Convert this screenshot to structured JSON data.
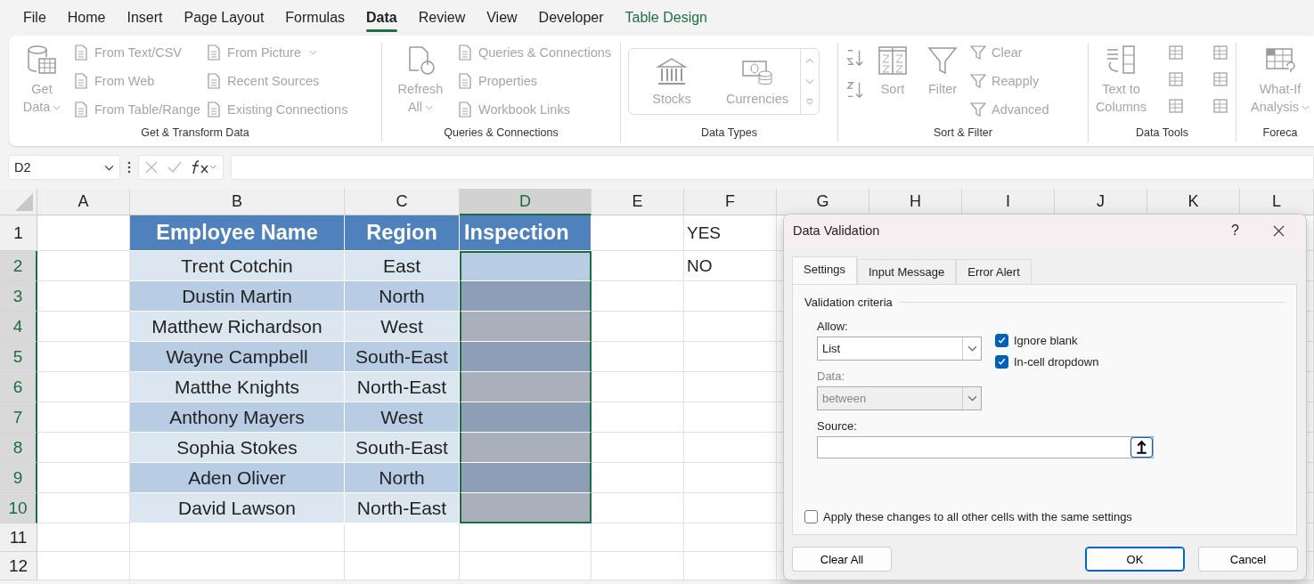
{
  "menu_tabs": [
    {
      "label": "File",
      "selected": false,
      "kind": "standard"
    },
    {
      "label": "Home",
      "selected": false,
      "kind": "standard"
    },
    {
      "label": "Insert",
      "selected": false,
      "kind": "standard"
    },
    {
      "label": "Page Layout",
      "selected": false,
      "kind": "standard"
    },
    {
      "label": "Formulas",
      "selected": false,
      "kind": "standard"
    },
    {
      "label": "Data",
      "selected": true,
      "kind": "standard"
    },
    {
      "label": "Review",
      "selected": false,
      "kind": "standard"
    },
    {
      "label": "View",
      "selected": false,
      "kind": "standard"
    },
    {
      "label": "Developer",
      "selected": false,
      "kind": "standard"
    },
    {
      "label": "Table Design",
      "selected": false,
      "kind": "contextual"
    }
  ],
  "ribbon": {
    "disabled": true,
    "groups": [
      {
        "label": "Get & Transform Data",
        "columns": [
          {
            "kind": "large",
            "items": [
              {
                "label": "Get Data",
                "dropdown": true
              }
            ]
          },
          {
            "kind": "small",
            "items": [
              {
                "label": "From Text/CSV",
                "dropdown": false
              },
              {
                "label": "From Web",
                "dropdown": false
              },
              {
                "label": "From Table/Range",
                "dropdown": false
              }
            ]
          },
          {
            "kind": "small",
            "items": [
              {
                "label": "From Picture",
                "dropdown": true
              },
              {
                "label": "Recent Sources",
                "dropdown": false
              },
              {
                "label": "Existing Connections",
                "dropdown": false
              }
            ]
          }
        ]
      },
      {
        "label": "Queries & Connections",
        "columns": [
          {
            "kind": "large",
            "items": [
              {
                "label": "Refresh All",
                "dropdown": true
              }
            ]
          },
          {
            "kind": "small",
            "items": [
              {
                "label": "Queries & Connections",
                "dropdown": false
              },
              {
                "label": "Properties",
                "dropdown": false
              },
              {
                "label": "Workbook Links",
                "dropdown": false
              }
            ]
          }
        ]
      },
      {
        "label": "Data Types",
        "columns": [
          {
            "kind": "gallery",
            "items": [
              {
                "label": "Stocks"
              },
              {
                "label": "Currencies"
              }
            ]
          }
        ]
      },
      {
        "label": "Sort & Filter",
        "columns": [
          {
            "kind": "sortpair"
          },
          {
            "kind": "large",
            "items": [
              {
                "label": "Sort",
                "dropdown": false
              }
            ]
          },
          {
            "kind": "large",
            "items": [
              {
                "label": "Filter",
                "dropdown": false
              }
            ]
          },
          {
            "kind": "small",
            "items": [
              {
                "label": "Clear",
                "dropdown": false
              },
              {
                "label": "Reapply",
                "dropdown": false
              },
              {
                "label": "Advanced",
                "dropdown": false
              }
            ]
          }
        ]
      },
      {
        "label": "Data Tools",
        "columns": [
          {
            "kind": "large",
            "items": [
              {
                "label": "Text to Columns",
                "dropdown": false
              }
            ]
          },
          {
            "kind": "tools"
          }
        ]
      },
      {
        "label": "Foreca",
        "columns": [
          {
            "kind": "large",
            "items": [
              {
                "label": "What-If Analysis",
                "dropdown": true
              }
            ]
          }
        ]
      }
    ]
  },
  "formula_bar": {
    "name_box": "D2"
  },
  "sheet": {
    "columns": [
      {
        "label": "A",
        "selected": false
      },
      {
        "label": "B",
        "selected": false
      },
      {
        "label": "C",
        "selected": false
      },
      {
        "label": "D",
        "selected": true
      },
      {
        "label": "E",
        "selected": false
      },
      {
        "label": "F",
        "selected": false
      },
      {
        "label": "G",
        "selected": false
      },
      {
        "label": "H",
        "selected": false
      },
      {
        "label": "I",
        "selected": false
      },
      {
        "label": "J",
        "selected": false
      },
      {
        "label": "K",
        "selected": false
      },
      {
        "label": "L",
        "selected": false
      }
    ],
    "rows": [
      {
        "number": "1",
        "selected": false,
        "kind": "header",
        "name": "Employee Name",
        "region": "Region",
        "inspection": "Inspection",
        "column_f": "YES"
      },
      {
        "number": "2",
        "selected": true,
        "kind": "data",
        "name": "Trent Cotchin",
        "region": "East",
        "column_f": "NO"
      },
      {
        "number": "3",
        "selected": true,
        "kind": "data",
        "name": "Dustin Martin",
        "region": "North"
      },
      {
        "number": "4",
        "selected": true,
        "kind": "data",
        "name": "Matthew Richardson",
        "region": "West"
      },
      {
        "number": "5",
        "selected": true,
        "kind": "data",
        "name": "Wayne Campbell",
        "region": "South-East"
      },
      {
        "number": "6",
        "selected": true,
        "kind": "data",
        "name": "Matthe Knights",
        "region": "North-East"
      },
      {
        "number": "7",
        "selected": true,
        "kind": "data",
        "name": "Anthony Mayers",
        "region": "West"
      },
      {
        "number": "8",
        "selected": true,
        "kind": "data",
        "name": "Sophia Stokes",
        "region": "South-East"
      },
      {
        "number": "9",
        "selected": true,
        "kind": "data",
        "name": "Aden Oliver",
        "region": "North"
      },
      {
        "number": "10",
        "selected": true,
        "kind": "data",
        "name": "David Lawson",
        "region": "North-East"
      },
      {
        "number": "11",
        "selected": false,
        "kind": "empty"
      },
      {
        "number": "12",
        "selected": false,
        "kind": "empty"
      }
    ]
  },
  "dialog": {
    "title": "Data Validation",
    "help": "?",
    "tabs": [
      {
        "label": "Settings",
        "selected": true
      },
      {
        "label": "Input Message",
        "selected": false
      },
      {
        "label": "Error Alert",
        "selected": false
      }
    ],
    "section": "Validation criteria",
    "allow": {
      "label": "Allow:",
      "value": "List",
      "disabled": false
    },
    "data": {
      "label": "Data:",
      "value": "between",
      "disabled": true
    },
    "checkboxes": [
      {
        "label": "Ignore blank",
        "checked": true
      },
      {
        "label": "In-cell dropdown",
        "checked": true
      }
    ],
    "source": {
      "label": "Source:"
    },
    "apply_all": {
      "label": "Apply these changes to all other cells with the same settings",
      "checked": false
    },
    "buttons": [
      {
        "label": "Clear All",
        "kind": "secondary"
      },
      {
        "label": "OK",
        "kind": "primary"
      },
      {
        "label": "Cancel",
        "kind": "secondary"
      }
    ]
  }
}
